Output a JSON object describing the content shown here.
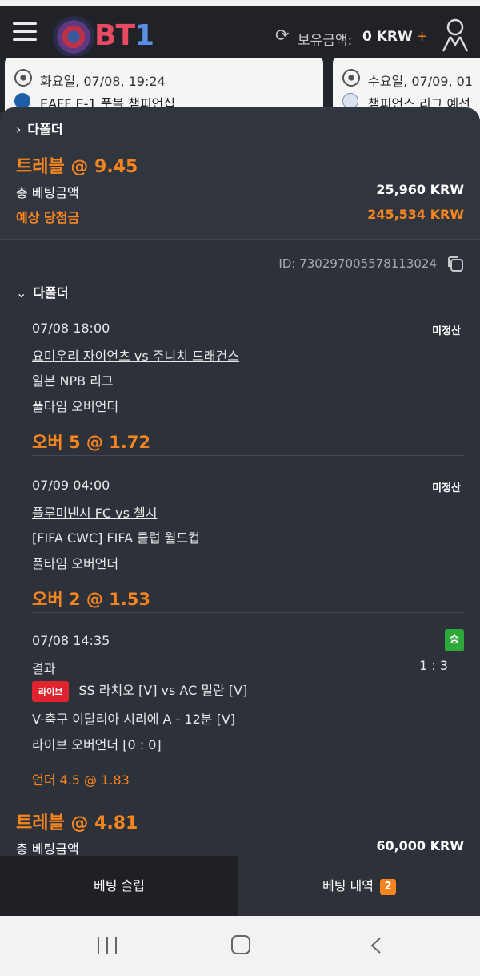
{
  "header": {
    "logo": "BT1",
    "balance_label": "보유금액:",
    "balance_value": "0 KRW",
    "plus": "+"
  },
  "match_cards": [
    {
      "date": "화요일, 07/08, 19:24",
      "league": "EAFF E-1 풋볼 챔피언십"
    },
    {
      "date": "수요일, 07/09, 01",
      "league": "챔피언스 리그 예선"
    }
  ],
  "summary": {
    "collapsed_label": "다폴더",
    "title": "트레블 @ 9.45",
    "stake_label": "총 베팅금액",
    "stake_value": "25,960 KRW",
    "payout_label": "예상 당첨금",
    "payout_value": "245,534 KRW"
  },
  "bet": {
    "id": "ID: 730297005578113024",
    "expanded_label": "다폴더",
    "selections": [
      {
        "datetime": "07/08 18:00",
        "status": "미정산",
        "match": "요미우리 자이언츠 vs 주니치 드래건스",
        "league": "일본 NPB 리그",
        "market": "풀타임 오버언더",
        "pick": "오버 5 @ 1.72"
      },
      {
        "datetime": "07/09 04:00",
        "status": "미정산",
        "match": "플루미넨시 FC vs 첼시",
        "league": "[FIFA CWC] FIFA 클럽 월드컵",
        "market": "풀타임 오버언더",
        "pick": "오버 2 @ 1.53"
      },
      {
        "datetime": "07/08 14:35",
        "status": "승",
        "result_label": "결과",
        "score": "1 : 3",
        "live_badge": "라이브",
        "match": "SS 라치오 [V] vs AC 밀란 [V]",
        "league": "V-축구 이탈리아 시리에 A - 12분 [V]",
        "market": "라이브 오버언더 [0 : 0]",
        "pick": "언더 4.5 @ 1.83"
      }
    ]
  },
  "next_bet": {
    "title": "트레블 @ 4.81",
    "stake_label": "총 베팅금액",
    "stake_value": "60,000 KRW"
  },
  "tabs": {
    "slip": "베팅 슬립",
    "history": "베팅 내역",
    "history_count": "2"
  },
  "colors": {
    "accent": "#f7851f",
    "win": "#2fa83a",
    "live": "#e0242f",
    "background": "#2d3139"
  }
}
